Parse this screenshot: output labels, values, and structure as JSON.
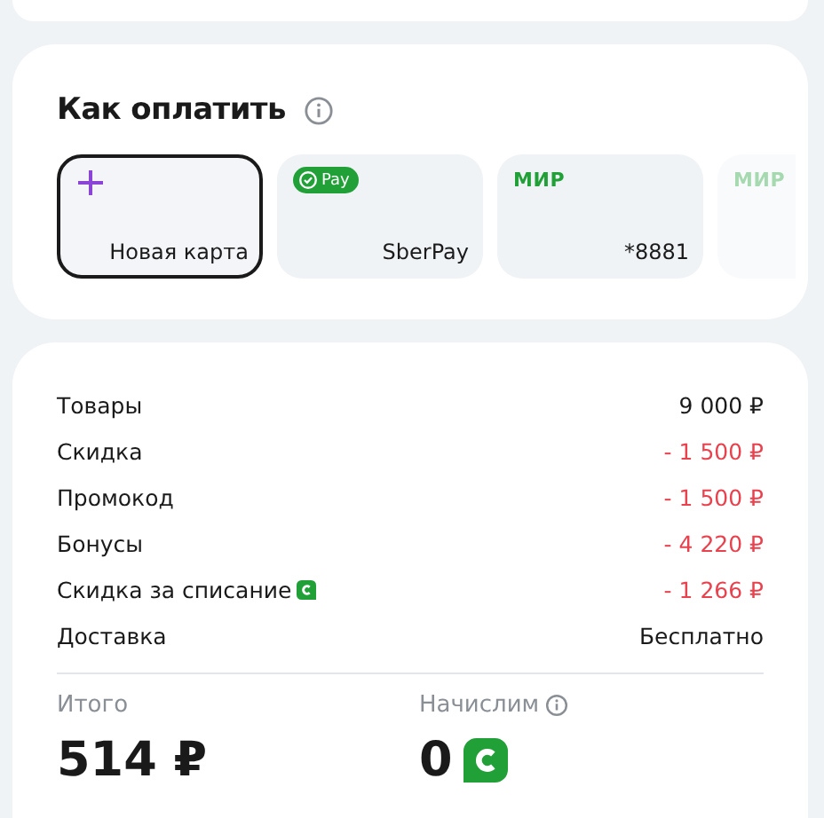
{
  "payment": {
    "title": "Как оплатить",
    "options": [
      {
        "kind": "new",
        "label": "Новая карта",
        "selected": true
      },
      {
        "kind": "sberpay",
        "badge": "Pay",
        "label": "SberPay",
        "selected": false
      },
      {
        "kind": "mir",
        "logo": "МИР",
        "label": "*8881",
        "selected": false
      },
      {
        "kind": "mir",
        "logo": "МИР",
        "faded": true,
        "selected": false
      }
    ]
  },
  "summary": {
    "rows": [
      {
        "label": "Товары",
        "value": "9 000 ₽",
        "kind": "amount"
      },
      {
        "label": "Скидка",
        "value": "- 1 500 ₽",
        "kind": "discount"
      },
      {
        "label": "Промокод",
        "value": "- 1 500 ₽",
        "kind": "discount"
      },
      {
        "label": "Бонусы",
        "value": "- 4 220 ₽",
        "kind": "discount"
      },
      {
        "label": "Скидка за списание",
        "value": "- 1 266 ₽",
        "kind": "discount",
        "bonus_icon": true
      },
      {
        "label": "Доставка",
        "value": "Бесплатно",
        "kind": "amount"
      }
    ],
    "total": {
      "label": "Итого",
      "value": "514 ₽"
    },
    "accrual": {
      "label": "Начислим",
      "value": "0"
    }
  }
}
